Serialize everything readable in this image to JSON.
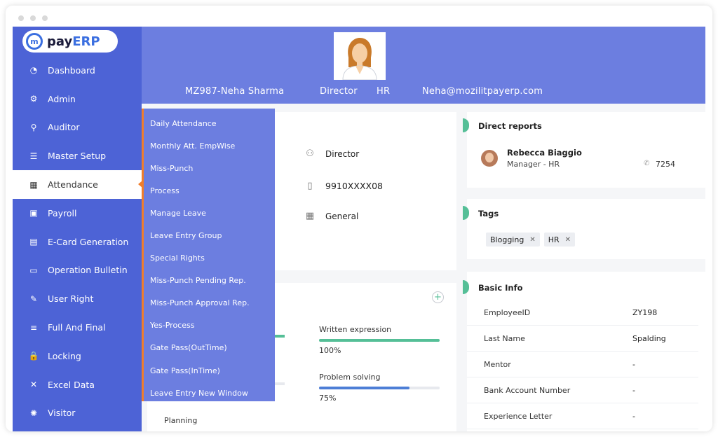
{
  "brand": {
    "mark": "m",
    "pay": "pay",
    "erp": "ERP"
  },
  "sidebar": {
    "items": [
      {
        "label": "Dashboard",
        "icon": "dashboard-icon",
        "glyph": "◔"
      },
      {
        "label": "Admin",
        "icon": "admin-icon",
        "glyph": "⚙"
      },
      {
        "label": "Auditor",
        "icon": "user-icon",
        "glyph": "⚲"
      },
      {
        "label": "Master Setup",
        "icon": "sliders-icon",
        "glyph": "☰"
      },
      {
        "label": "Attendance",
        "icon": "calendar-icon",
        "glyph": "▦"
      },
      {
        "label": "Payroll",
        "icon": "money-icon",
        "glyph": "▣"
      },
      {
        "label": "E-Card Generation",
        "icon": "id-card-icon",
        "glyph": "▤"
      },
      {
        "label": "Operation Bulletin",
        "icon": "briefcase-icon",
        "glyph": "▭"
      },
      {
        "label": "User Right",
        "icon": "user-edit-icon",
        "glyph": "✎"
      },
      {
        "label": "Full And Final",
        "icon": "list-icon",
        "glyph": "≡"
      },
      {
        "label": "Locking",
        "icon": "lock-icon",
        "glyph": "🔒"
      },
      {
        "label": "Excel Data",
        "icon": "excel-icon",
        "glyph": "✕"
      },
      {
        "label": "Visitor",
        "icon": "visitor-icon",
        "glyph": "✺"
      }
    ]
  },
  "header": {
    "employee": "MZ987-Neha Sharma",
    "designation": "Director",
    "department": "HR",
    "email": "Neha@mozilitpayerp.com"
  },
  "submenu": {
    "items": [
      "Daily Attendance",
      "Monthly Att. EmpWise",
      "Miss-Punch",
      "Process",
      "Manage Leave",
      "Leave Entry Group",
      "Special Rights",
      "Miss-Punch Pending Rep.",
      "Miss-Punch Approval Rep.",
      "Yes-Process",
      "Gate Pass(OutTime)",
      "Gate Pass(InTime)",
      "Leave Entry New Window"
    ]
  },
  "profile": {
    "role": "Director",
    "phone": "9910XXXX08",
    "shift": "General"
  },
  "skills": {
    "add_label": "+",
    "items": [
      {
        "label": "Written expression",
        "value": "100%",
        "fraction": 1.0,
        "color": "#55bf97"
      },
      {
        "label": "Problem solving",
        "value": "75%",
        "fraction": 0.75,
        "color": "#4d7ed6"
      }
    ],
    "partial_label": "Planning"
  },
  "direct_reports": {
    "title": "Direct reports",
    "name": "Rebecca Biaggio",
    "role": "Manager - HR",
    "ext": "7254"
  },
  "tags": {
    "title": "Tags",
    "items": [
      "Blogging",
      "HR"
    ],
    "remove_glyph": "✕"
  },
  "basic_info": {
    "title": "Basic Info",
    "rows": [
      {
        "label": "EmployeeID",
        "value": "ZY198"
      },
      {
        "label": "Last Name",
        "value": "Spalding"
      },
      {
        "label": "Mentor",
        "value": "-"
      },
      {
        "label": "Bank Account Number",
        "value": "-"
      },
      {
        "label": "Experience Letter",
        "value": "-"
      }
    ]
  },
  "colors": {
    "sidebar": "#4d63d6",
    "header": "#6c7ee0",
    "accent_orange": "#f07d2c",
    "accent_green": "#55bf97"
  }
}
